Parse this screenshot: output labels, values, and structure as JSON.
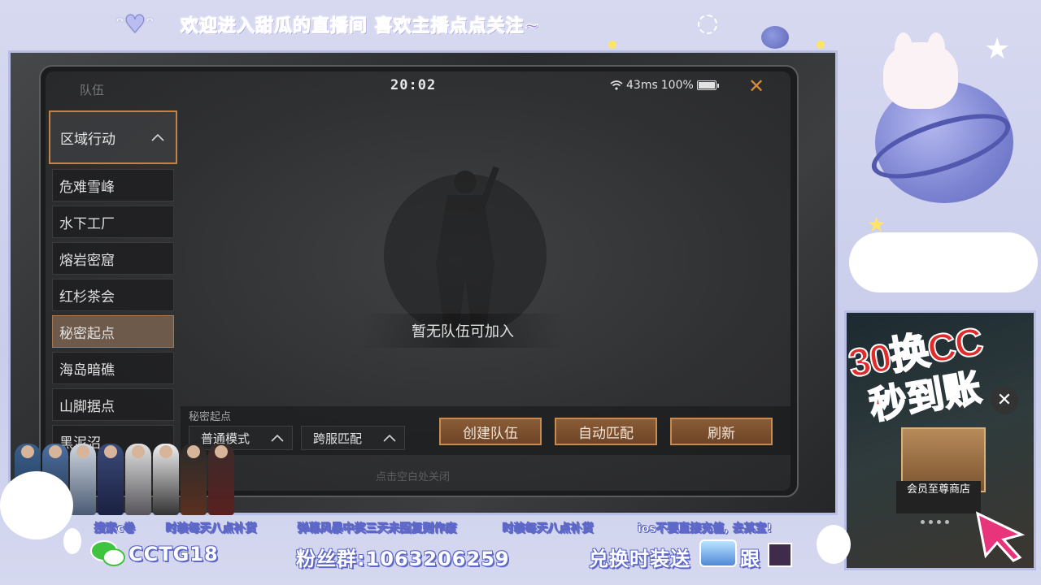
{
  "banner": {
    "text": "欢迎进入甜瓜的直播间 喜欢主播点点关注~"
  },
  "game": {
    "team_title": "队伍",
    "clock": "20:02",
    "ping": "43ms",
    "battery": "100%",
    "sidebar": {
      "header": "区域行动",
      "items": [
        {
          "label": "危难雪峰",
          "active": false
        },
        {
          "label": "水下工厂",
          "active": false
        },
        {
          "label": "熔岩密窟",
          "active": false
        },
        {
          "label": "红杉茶会",
          "active": false
        },
        {
          "label": "秘密起点",
          "active": true
        },
        {
          "label": "海岛暗礁",
          "active": false
        },
        {
          "label": "山脚据点",
          "active": false
        },
        {
          "label": "黑泥沼",
          "active": false
        }
      ]
    },
    "empty_message": "暂无队伍可加入",
    "mode_label": "秘密起点",
    "dropdowns": {
      "mode": "普通模式",
      "match": "跨服匹配"
    },
    "buttons": {
      "create": "创建队伍",
      "auto_match": "自动匹配",
      "refresh": "刷新"
    },
    "hint": "点击空白处关闭"
  },
  "overlay": {
    "ad": {
      "line1": "30换CC",
      "line2": "秒到账",
      "shop": "会员至尊商店"
    },
    "tickers": [
      "搜索c卷",
      "时装每天八点补货",
      "弹幕风暴中奖三天未回复则作废",
      "时装每天八点补货",
      "ios不要直接充值, 去某宝!"
    ],
    "bottom": {
      "id": "CCTG18",
      "fans_group": "粉丝群:1063206259",
      "exchange": "兑换时装送",
      "follow": "跟"
    }
  },
  "colors": {
    "accent": "#c98a4f",
    "active_item": "#6e5a4b",
    "overlay_bg": "#d7d9f0",
    "overlay_stroke": "#5d67c7"
  }
}
